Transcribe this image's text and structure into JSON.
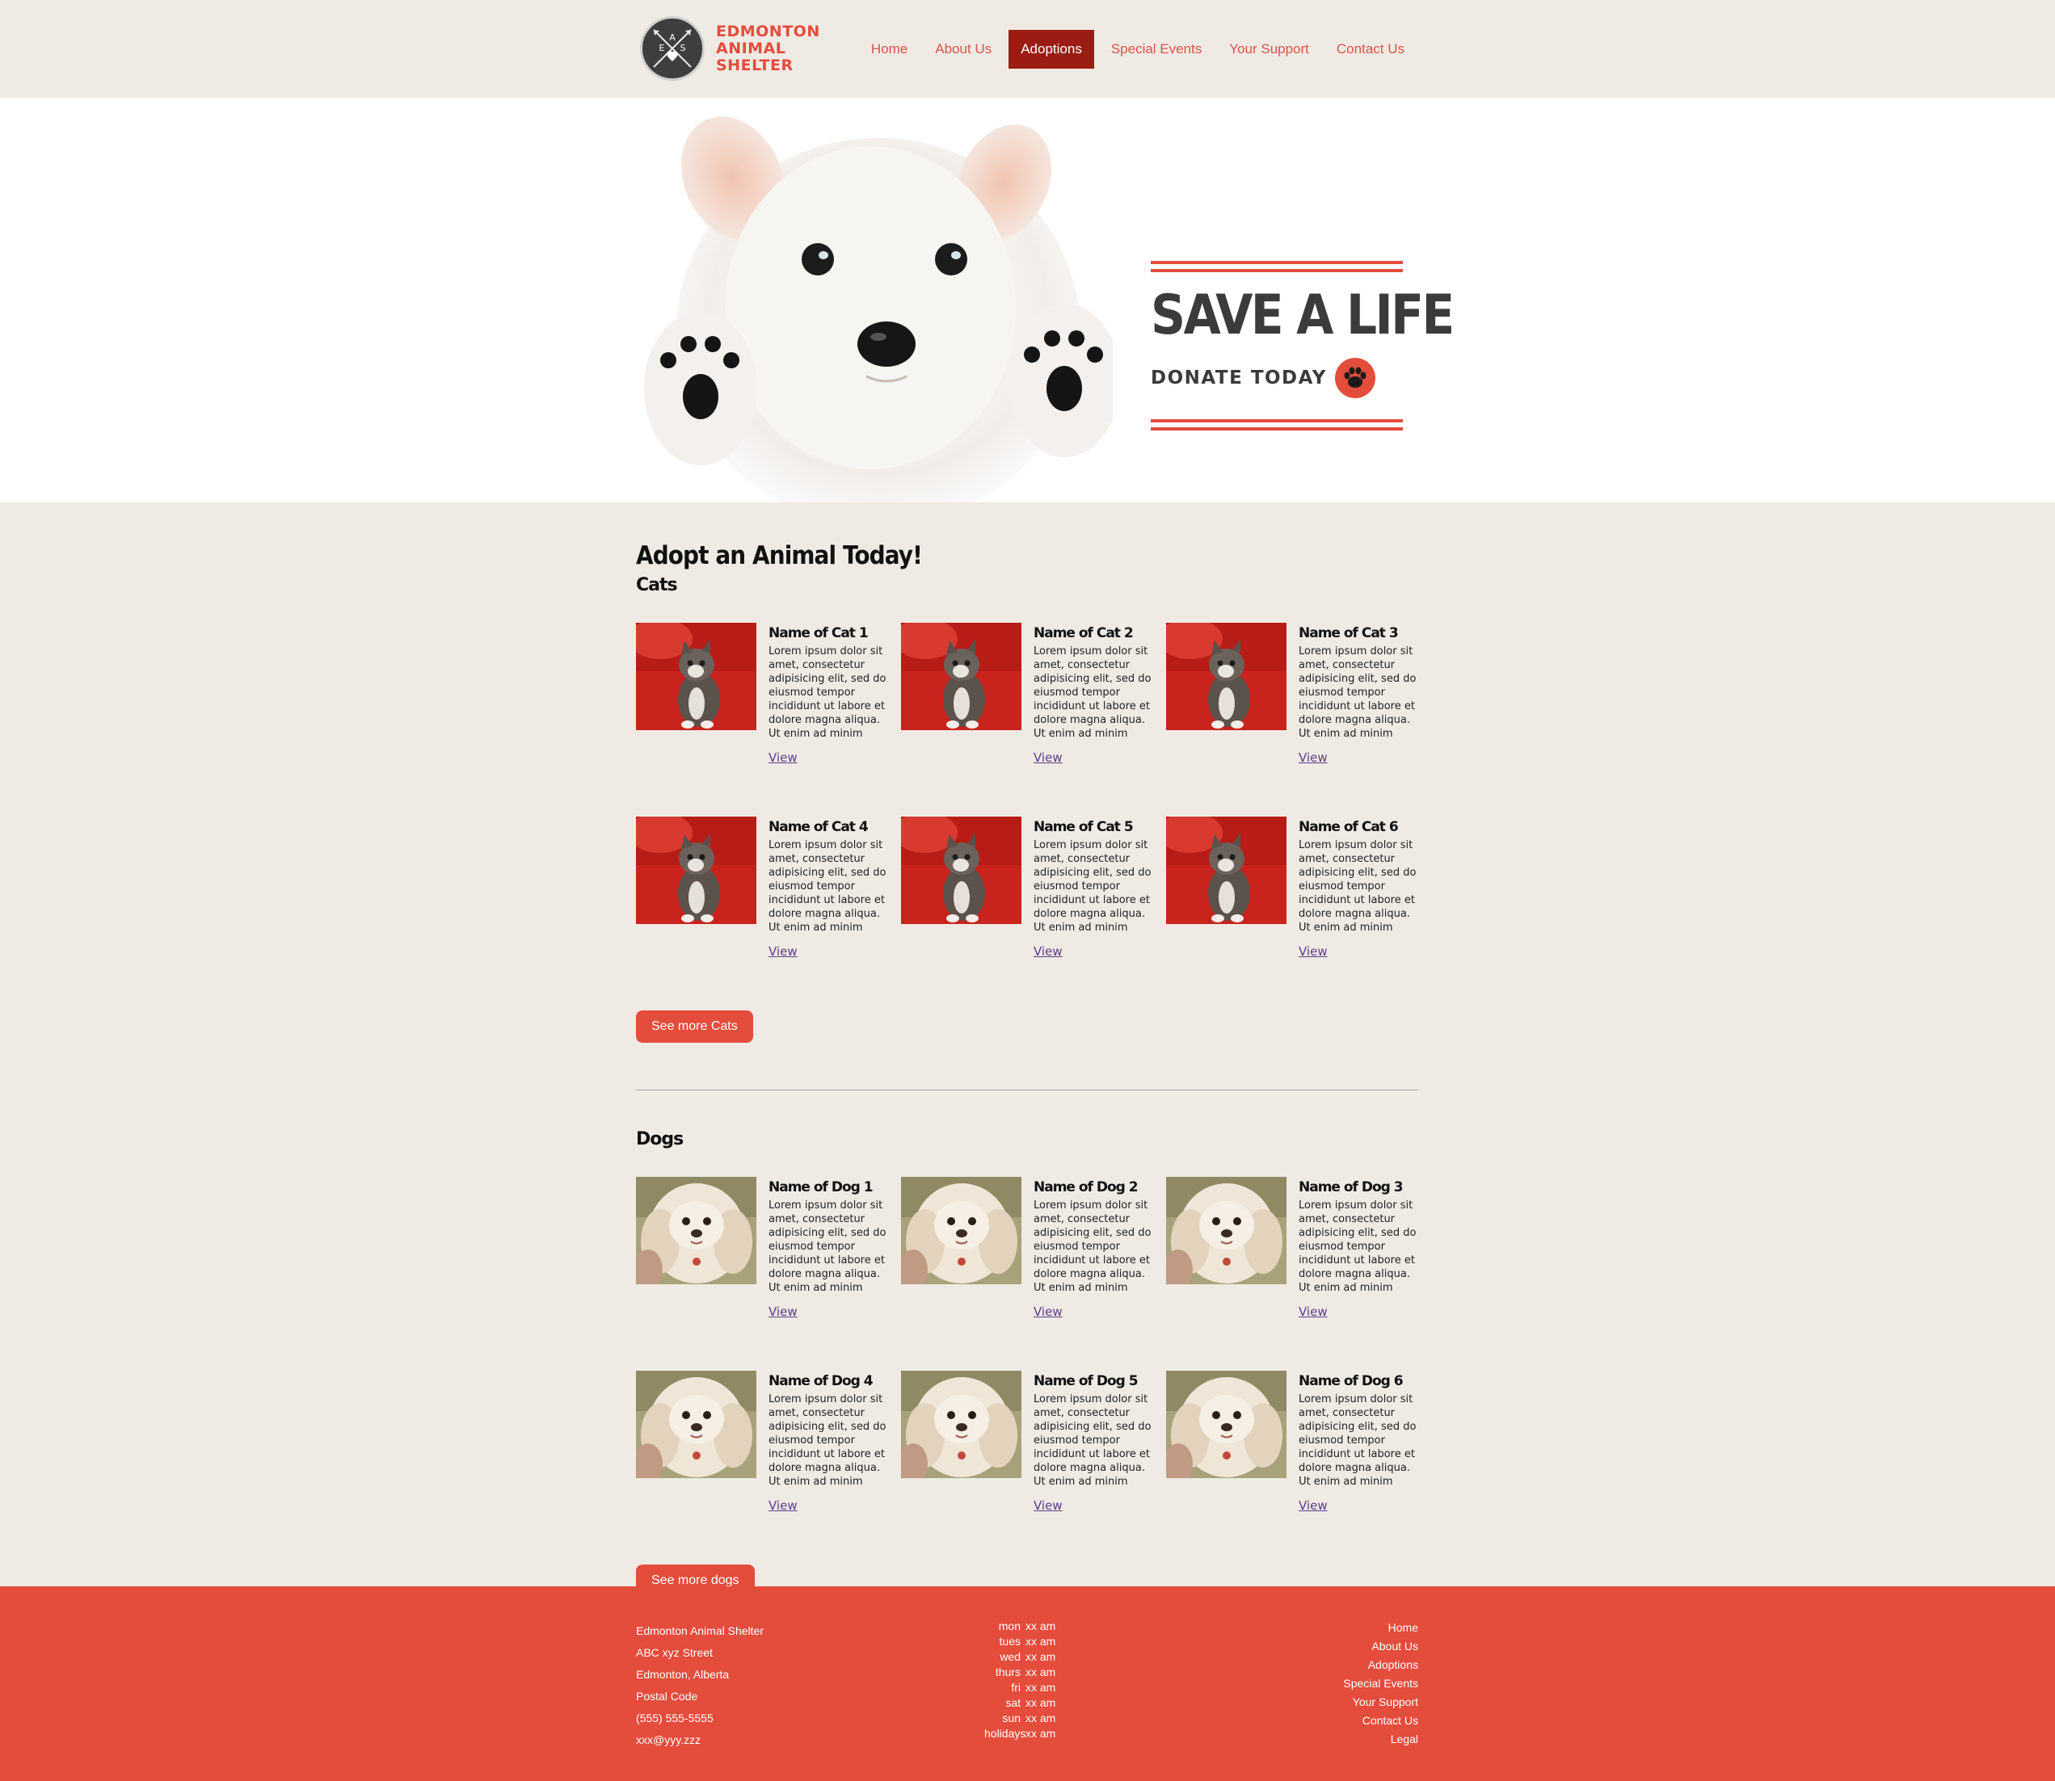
{
  "brand": {
    "line1": "EDMONTON",
    "line2": "ANIMAL",
    "line3": "SHELTER",
    "badge_letters": [
      "A",
      "E",
      "S"
    ]
  },
  "nav": [
    {
      "label": "Home",
      "active": false
    },
    {
      "label": "About Us",
      "active": false
    },
    {
      "label": "Adoptions",
      "active": true
    },
    {
      "label": "Special Events",
      "active": false
    },
    {
      "label": "Your Support",
      "active": false
    },
    {
      "label": "Contact Us",
      "active": false
    }
  ],
  "hero": {
    "headline": "SAVE A LIFE",
    "cta": "DONATE TODAY",
    "cta_icon": "paw-icon"
  },
  "main": {
    "title": "Adopt an Animal Today!",
    "cats": {
      "heading": "Cats",
      "items": [
        {
          "name": "Name of Cat 1",
          "text": "Lorem ipsum dolor sit amet, consectetur adipisicing elit, sed do eiusmod tempor incididunt ut labore et dolore magna aliqua. Ut enim ad minim",
          "link": "View"
        },
        {
          "name": "Name of Cat 2",
          "text": "Lorem ipsum dolor sit amet, consectetur adipisicing elit, sed do eiusmod tempor incididunt ut labore et dolore magna aliqua. Ut enim ad minim",
          "link": "View"
        },
        {
          "name": "Name of Cat 3",
          "text": "Lorem ipsum dolor sit amet, consectetur adipisicing elit, sed do eiusmod tempor incididunt ut labore et dolore magna aliqua. Ut enim ad minim",
          "link": "View"
        },
        {
          "name": "Name of Cat 4",
          "text": "Lorem ipsum dolor sit amet, consectetur adipisicing elit, sed do eiusmod tempor incididunt ut labore et dolore magna aliqua. Ut enim ad minim",
          "link": "View"
        },
        {
          "name": "Name of Cat 5",
          "text": "Lorem ipsum dolor sit amet, consectetur adipisicing elit, sed do eiusmod tempor incididunt ut labore et dolore magna aliqua. Ut enim ad minim",
          "link": "View"
        },
        {
          "name": "Name of Cat 6",
          "text": "Lorem ipsum dolor sit amet, consectetur adipisicing elit, sed do eiusmod tempor incididunt ut labore et dolore magna aliqua. Ut enim ad minim",
          "link": "View"
        }
      ],
      "more": "See more Cats"
    },
    "dogs": {
      "heading": "Dogs",
      "items": [
        {
          "name": "Name of Dog 1",
          "text": "Lorem ipsum dolor sit amet, consectetur adipisicing elit, sed do eiusmod tempor incididunt ut labore et dolore magna aliqua. Ut enim ad minim",
          "link": "View"
        },
        {
          "name": "Name of Dog 2",
          "text": "Lorem ipsum dolor sit amet, consectetur adipisicing elit, sed do eiusmod tempor incididunt ut labore et dolore magna aliqua. Ut enim ad minim",
          "link": "View"
        },
        {
          "name": "Name of Dog 3",
          "text": "Lorem ipsum dolor sit amet, consectetur adipisicing elit, sed do eiusmod tempor incididunt ut labore et dolore magna aliqua. Ut enim ad minim",
          "link": "View"
        },
        {
          "name": "Name of Dog 4",
          "text": "Lorem ipsum dolor sit amet, consectetur adipisicing elit, sed do eiusmod tempor incididunt ut labore et dolore magna aliqua. Ut enim ad minim",
          "link": "View"
        },
        {
          "name": "Name of Dog 5",
          "text": "Lorem ipsum dolor sit amet, consectetur adipisicing elit, sed do eiusmod tempor incididunt ut labore et dolore magna aliqua. Ut enim ad minim",
          "link": "View"
        },
        {
          "name": "Name of Dog 6",
          "text": "Lorem ipsum dolor sit amet, consectetur adipisicing elit, sed do eiusmod tempor incididunt ut labore et dolore magna aliqua. Ut enim ad minim",
          "link": "View"
        }
      ],
      "more": "See more dogs"
    }
  },
  "footer": {
    "address": [
      "Edmonton Animal Shelter",
      "ABC xyz Street",
      "Edmonton, Alberta",
      "Postal Code",
      "(555) 555-5555",
      "xxx@yyy.zzz"
    ],
    "hours": [
      {
        "day": "mon",
        "time": "xx am"
      },
      {
        "day": "tues",
        "time": "xx am"
      },
      {
        "day": "wed",
        "time": "xx am"
      },
      {
        "day": "thurs",
        "time": "xx am"
      },
      {
        "day": "fri",
        "time": "xx am"
      },
      {
        "day": "sat",
        "time": "xx am"
      },
      {
        "day": "sun",
        "time": "xx am"
      },
      {
        "day": "holidays",
        "time": "xx am"
      }
    ],
    "links": [
      "Home",
      "About Us",
      "Adoptions",
      "Special Events",
      "Your Support",
      "Contact Us",
      "Legal"
    ]
  },
  "colors": {
    "accent": "#e44c3c",
    "nav_active": "#9a1c13",
    "page_bg": "#efeae4",
    "link": "#5b3d8a"
  }
}
